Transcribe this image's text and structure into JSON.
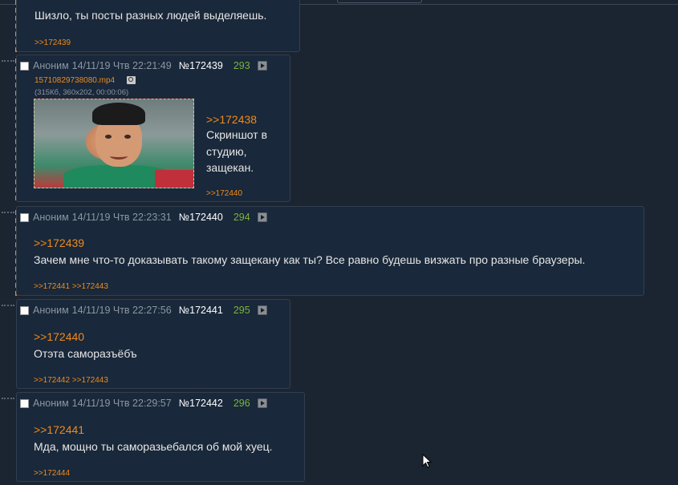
{
  "top_post": {
    "message": "Шизло, ты посты разных людей выделяешь.",
    "backlinks": ">>172439"
  },
  "posts": [
    {
      "author": "Аноним",
      "date": "14/11/19 Чтв 22:21:49",
      "number": "№172439",
      "count": "293",
      "file": {
        "name": "15710829738080.mp4",
        "meta": "(315Кб, 360x202, 00:00:06)"
      },
      "reply_to": ">>172438",
      "message_lines": [
        "Скриншот в",
        "студию,",
        "защекан."
      ],
      "backlinks": ">>172440"
    },
    {
      "author": "Аноним",
      "date": "14/11/19 Чтв 22:23:31",
      "number": "№172440",
      "count": "294",
      "reply_to": ">>172439",
      "message": "Зачем мне что-то доказывать такому защекану как ты? Все равно будешь визжать про разные браузеры.",
      "backlinks": ">>172441 >>172443"
    },
    {
      "author": "Аноним",
      "date": "14/11/19 Чтв 22:27:56",
      "number": "№172441",
      "count": "295",
      "reply_to": ">>172440",
      "message": "Отэта саморазъёбъ",
      "backlinks": ">>172442 >>172443"
    },
    {
      "author": "Аноним",
      "date": "14/11/19 Чтв 22:29:57",
      "number": "№172442",
      "count": "296",
      "reply_to": ">>172441",
      "message": "Мда, мощно ты саморазьебался об мой хуец.",
      "backlinks": ">>172444"
    }
  ],
  "colors": {
    "background": "#1b2431",
    "post_background": "#19283a",
    "link": "#f08a1c",
    "count": "#7ab33d",
    "meta": "#8d96a3"
  },
  "icons": [
    "checkbox-icon",
    "play-icon",
    "magnify-icon",
    "mouse-cursor-icon"
  ]
}
